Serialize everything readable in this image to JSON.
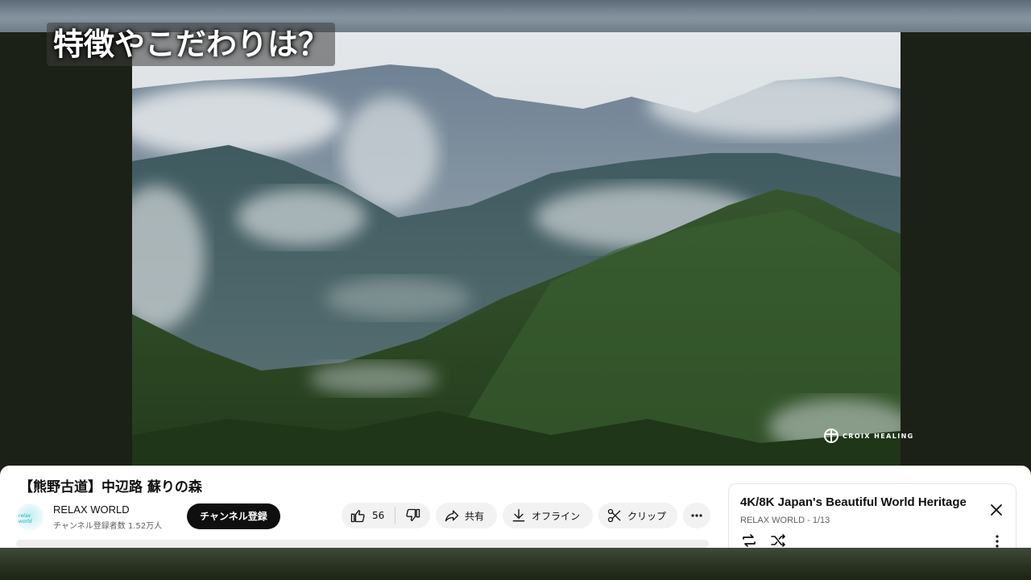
{
  "video": {
    "caption": "特徴やこだわりは？",
    "watermark": "CROIX HEALING",
    "title": "【熊野古道】中辺路 蘇りの森"
  },
  "channel": {
    "name": "RELAX WORLD",
    "subscribers": "チャンネル登録者数 1.52万人",
    "subscribe_label": "チャンネル登録",
    "avatar_text": "relax world"
  },
  "actions": {
    "like_count": "56",
    "share_label": "共有",
    "download_label": "オフライン",
    "clip_label": "クリップ"
  },
  "playlist": {
    "title": "4K/8K Japan's Beautiful World Heritage",
    "subtitle": "RELAX WORLD - 1/13"
  },
  "icons": {
    "like": "thumbs-up-icon",
    "dislike": "thumbs-down-icon",
    "share": "share-arrow-icon",
    "download": "download-icon",
    "clip": "scissors-icon",
    "more": "more-horizontal-icon",
    "close": "close-icon",
    "loop": "loop-icon",
    "shuffle": "shuffle-icon",
    "more_vertical": "more-vertical-icon"
  },
  "colors": {
    "subscribe_bg": "#0f0f0f",
    "pill_bg": "#f2f2f2",
    "frame_bg": "#1b2116"
  }
}
